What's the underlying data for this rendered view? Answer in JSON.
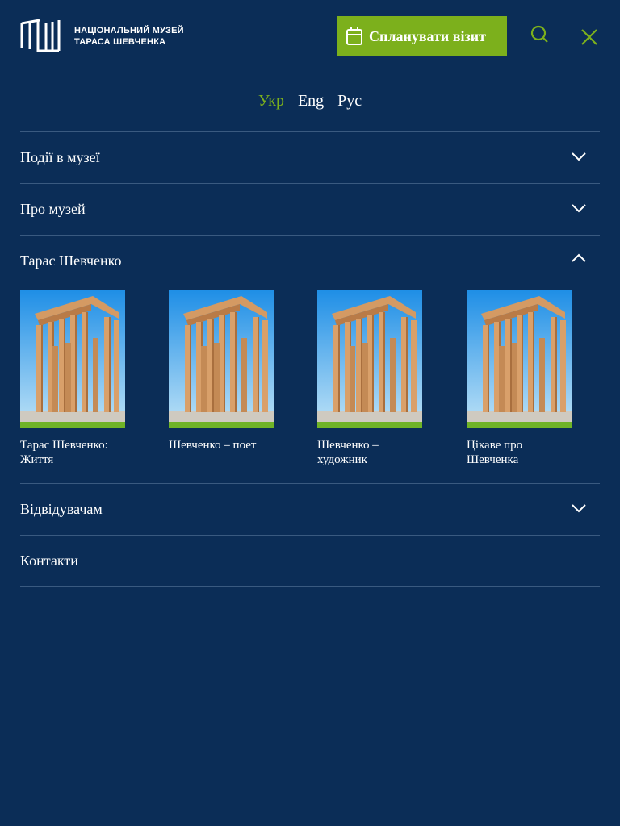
{
  "header": {
    "logo_line1": "НАЦІОНАЛЬНИЙ МУЗЕЙ",
    "logo_line2": "ТАРАСА ШЕВЧЕНКА",
    "plan_visit_label": "Спланувати візит"
  },
  "languages": [
    "Укр",
    "Eng",
    "Рус"
  ],
  "menu": {
    "events": "Події в музеї",
    "about": "Про музей",
    "taras": "Тарас Шевченко",
    "visitors": "Відвідувачам",
    "contacts": "Контакти"
  },
  "cards": [
    {
      "title": "Тарас Шевченко: Життя"
    },
    {
      "title": "Шевченко – поет"
    },
    {
      "title": "Шевченко – художник"
    },
    {
      "title": "Цікаве про Шевченка"
    }
  ],
  "colors": {
    "background": "#0b2d57",
    "accent": "#7cb01c",
    "divider": "#3a5a80"
  }
}
